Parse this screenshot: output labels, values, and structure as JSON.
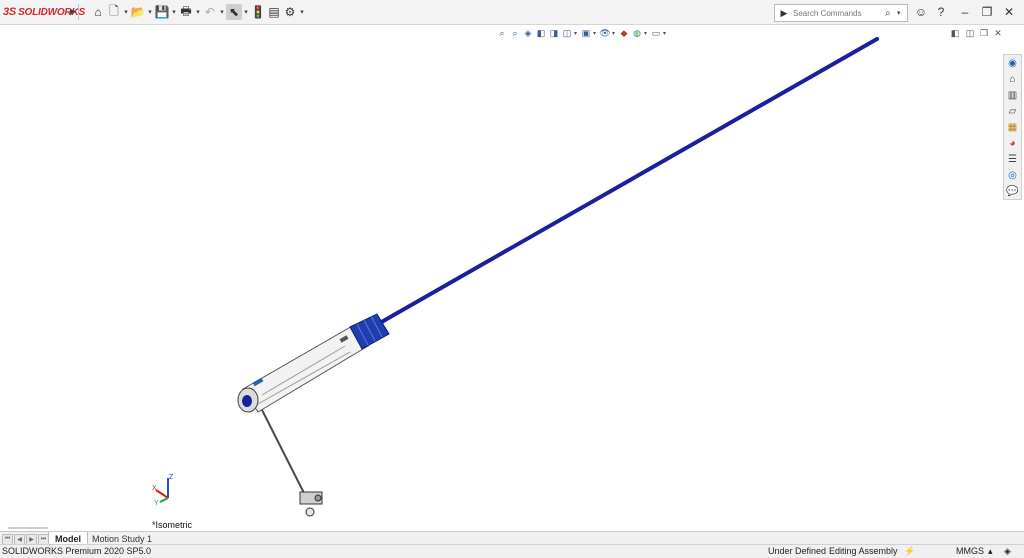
{
  "app": {
    "logo_prefix": "3S",
    "logo_text": "SOLIDWORKS"
  },
  "toolbar": {
    "icons": [
      "home-icon",
      "new-document-icon",
      "open-icon",
      "save-icon",
      "print-icon",
      "undo-icon",
      "select-icon",
      "rebuild-icon",
      "file-properties-icon",
      "options-icon"
    ]
  },
  "search": {
    "placeholder": "Search Commands"
  },
  "window_controls": [
    "minimize",
    "restore",
    "close"
  ],
  "view_toolbar": {
    "icons": [
      "zoom-to-fit-icon",
      "zoom-to-area-icon",
      "previous-view-icon",
      "section-view-icon",
      "dynamic-annotation-icon",
      "view-orientation-icon",
      "display-style-icon",
      "hide-show-icon",
      "edit-appearance-icon",
      "apply-scene-icon",
      "view-settings-icon"
    ]
  },
  "task_pane": {
    "icons": [
      "solidworks-resources-icon",
      "design-library-icon",
      "file-explorer-icon",
      "view-palette-icon",
      "appearances-icon",
      "custom-properties-icon",
      "solidworks-forum-icon",
      "3d-experience-icon",
      "chat-icon"
    ]
  },
  "viewport": {
    "view_name": "*Isometric",
    "triad_labels": {
      "x": "X",
      "y": "Y",
      "z": "Z"
    }
  },
  "tabs": {
    "model": "Model",
    "motion_study": "Motion Study 1"
  },
  "status": {
    "product": "SOLIDWORKS Premium 2020 SP5.0",
    "definition": "Under Defined",
    "mode": "Editing Assembly",
    "units": "MMGS"
  },
  "colors": {
    "rod": "#1a1f9c",
    "handle_blue": "#1e3fae",
    "brand_red": "#d8262b"
  }
}
